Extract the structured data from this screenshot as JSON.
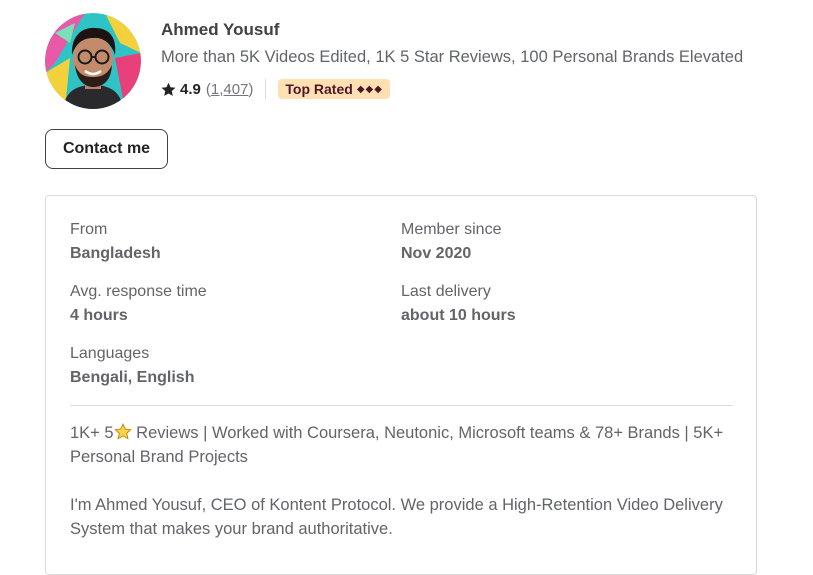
{
  "profile": {
    "name": "Ahmed Yousuf",
    "tagline": "More than 5K Videos Edited, 1K 5 Star Reviews, 100 Personal Brands Elevated",
    "rating": "4.9",
    "reviews_open": "(",
    "reviews_count": "1,407",
    "reviews_close": ")",
    "badge": "Top Rated",
    "badge_diamonds": "◆◆◆",
    "contact_label": "Contact me"
  },
  "icons": {
    "rating_star": "star-icon",
    "avatar": "avatar"
  },
  "colors": {
    "badge_bg": "#ffe0b3",
    "badge_text": "#4d1727",
    "text_primary": "#404145",
    "text_secondary": "#62646a",
    "border": "#dadbdd"
  },
  "stats": [
    {
      "label": "From",
      "value": "Bangladesh"
    },
    {
      "label": "Member since",
      "value": "Nov 2020"
    },
    {
      "label": "Avg. response time",
      "value": "4 hours"
    },
    {
      "label": "Last delivery",
      "value": "about 10 hours"
    },
    {
      "label": "Languages",
      "value": "Bengali, English"
    }
  ],
  "description": {
    "line1_before": "1K+ 5",
    "line1_after": " Reviews | Worked with Coursera, Neutonic, Microsoft teams & 78+ Brands | 5K+ Personal Brand Projects",
    "paragraph2": "I'm Ahmed Yousuf, CEO of Kontent Protocol. We provide a High-Retention Video Delivery System that makes your brand authoritative."
  }
}
